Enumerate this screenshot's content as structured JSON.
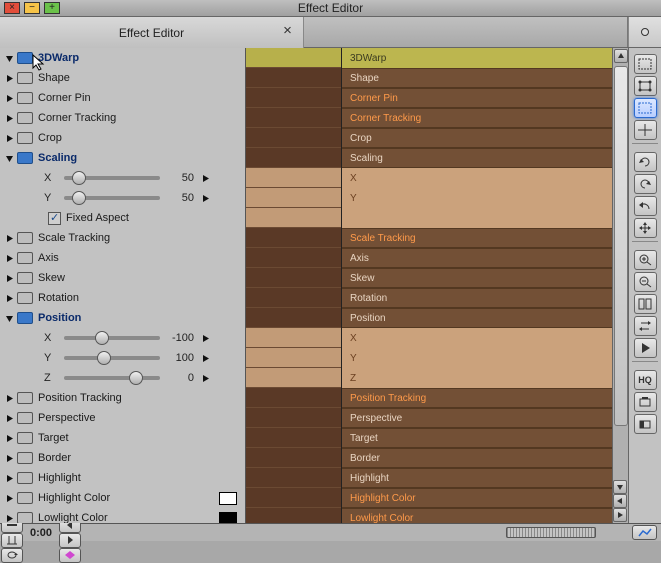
{
  "window": {
    "title": "Effect Editor",
    "tab_title": "Effect Editor"
  },
  "params": [
    {
      "key": "3dwarp",
      "label": "3DWarp",
      "kind": "head",
      "blue": true,
      "expanded": "down",
      "track": "3DWarp",
      "tstyle": "t-sel",
      "mstyle": "mid-sel"
    },
    {
      "key": "shape",
      "label": "Shape",
      "kind": "group",
      "expanded": "right",
      "track": "Shape",
      "tstyle": "t-dark",
      "mstyle": "mid-dark"
    },
    {
      "key": "cornerpin",
      "label": "Corner Pin",
      "kind": "group",
      "expanded": "right",
      "track": "Corner Pin",
      "tstyle": "t-dark t-hilite",
      "mstyle": "mid-dark"
    },
    {
      "key": "cornertracking",
      "label": "Corner Tracking",
      "kind": "group",
      "expanded": "right",
      "track": "Corner Tracking",
      "tstyle": "t-dark t-hilite",
      "mstyle": "mid-dark"
    },
    {
      "key": "crop",
      "label": "Crop",
      "kind": "group",
      "expanded": "right",
      "track": "Crop",
      "tstyle": "t-dark",
      "mstyle": "mid-dark"
    },
    {
      "key": "scaling",
      "label": "Scaling",
      "kind": "group",
      "blue": true,
      "expanded": "down",
      "track": "Scaling",
      "tstyle": "t-dark",
      "mstyle": "mid-dark"
    },
    {
      "key": "scale_x",
      "label": "X",
      "kind": "slider",
      "value": 50,
      "pos": 0.16,
      "track": "X",
      "tstyle": "t-lt",
      "mstyle": "mid-light"
    },
    {
      "key": "scale_y",
      "label": "Y",
      "kind": "slider",
      "value": 50,
      "pos": 0.16,
      "track": "Y",
      "tstyle": "t-lt",
      "mstyle": "mid-light"
    },
    {
      "key": "fixed_aspect",
      "label": "Fixed Aspect",
      "kind": "check",
      "checked": true,
      "tstyle": "t-lt",
      "mstyle": "mid-light"
    },
    {
      "key": "scaletracking",
      "label": "Scale Tracking",
      "kind": "group",
      "expanded": "right",
      "track": "Scale Tracking",
      "tstyle": "t-dark t-hilite",
      "mstyle": "mid-dark"
    },
    {
      "key": "axis",
      "label": "Axis",
      "kind": "group",
      "expanded": "right",
      "track": "Axis",
      "tstyle": "t-dark",
      "mstyle": "mid-dark"
    },
    {
      "key": "skew",
      "label": "Skew",
      "kind": "group",
      "expanded": "right",
      "track": "Skew",
      "tstyle": "t-dark",
      "mstyle": "mid-dark"
    },
    {
      "key": "rotation",
      "label": "Rotation",
      "kind": "group",
      "expanded": "right",
      "track": "Rotation",
      "tstyle": "t-dark",
      "mstyle": "mid-dark"
    },
    {
      "key": "position",
      "label": "Position",
      "kind": "group",
      "blue": true,
      "expanded": "down",
      "track": "Position",
      "tstyle": "t-dark",
      "mstyle": "mid-dark"
    },
    {
      "key": "pos_x",
      "label": "X",
      "kind": "slider",
      "value": -100,
      "pos": 0.4,
      "track": "X",
      "tstyle": "t-lt",
      "mstyle": "mid-light"
    },
    {
      "key": "pos_y",
      "label": "Y",
      "kind": "slider",
      "value": 100,
      "pos": 0.42,
      "track": "Y",
      "tstyle": "t-lt",
      "mstyle": "mid-light"
    },
    {
      "key": "pos_z",
      "label": "Z",
      "kind": "slider",
      "value": 0,
      "pos": 0.75,
      "track": "Z",
      "tstyle": "t-lt",
      "mstyle": "mid-light"
    },
    {
      "key": "positiontracking",
      "label": "Position Tracking",
      "kind": "group",
      "expanded": "right",
      "track": "Position Tracking",
      "tstyle": "t-dark t-hilite",
      "mstyle": "mid-dark"
    },
    {
      "key": "perspective",
      "label": "Perspective",
      "kind": "group",
      "expanded": "right",
      "track": "Perspective",
      "tstyle": "t-dark",
      "mstyle": "mid-dark"
    },
    {
      "key": "target",
      "label": "Target",
      "kind": "group",
      "expanded": "right",
      "track": "Target",
      "tstyle": "t-dark",
      "mstyle": "mid-dark"
    },
    {
      "key": "border",
      "label": "Border",
      "kind": "group",
      "expanded": "right",
      "track": "Border",
      "tstyle": "t-dark",
      "mstyle": "mid-dark"
    },
    {
      "key": "highlight",
      "label": "Highlight",
      "kind": "group",
      "expanded": "right",
      "track": "Highlight",
      "tstyle": "t-dark",
      "mstyle": "mid-dark"
    },
    {
      "key": "highlightcolor",
      "label": "Highlight Color",
      "kind": "color",
      "color": "#ffffff",
      "expanded": "right",
      "track": "Highlight Color",
      "tstyle": "t-dark t-hilite",
      "mstyle": "mid-dark"
    },
    {
      "key": "lowlightcolor",
      "label": "Lowlight Color",
      "kind": "color",
      "color": "#000000",
      "expanded": "right",
      "track": "Lowlight Color",
      "tstyle": "t-dark t-hilite",
      "mstyle": "mid-dark"
    }
  ],
  "transport": {
    "timecode": "0:00"
  },
  "tools": [
    {
      "name": "bounds-icon"
    },
    {
      "name": "transform-icon"
    },
    {
      "name": "select-icon",
      "active": true
    },
    {
      "name": "crosshair-icon"
    },
    {
      "name": "rotate-cw-icon"
    },
    {
      "name": "rotate-ccw-icon"
    },
    {
      "name": "undo-icon"
    },
    {
      "name": "move-icon"
    },
    {
      "name": "zoom-in-icon"
    },
    {
      "name": "zoom-out-icon"
    },
    {
      "name": "split-icon"
    },
    {
      "name": "swap-icon"
    },
    {
      "name": "play-icon"
    },
    {
      "name": "hq-icon"
    },
    {
      "name": "render-icon"
    },
    {
      "name": "render-range-icon"
    }
  ],
  "bottom_buttons": [
    {
      "name": "place-icon"
    },
    {
      "name": "strip-icon"
    },
    {
      "name": "io-icon"
    },
    {
      "name": "loop-icon"
    }
  ],
  "bottom_nav": [
    {
      "name": "rewind-icon"
    },
    {
      "name": "prev-icon"
    },
    {
      "name": "next-icon"
    },
    {
      "name": "kf-icon"
    }
  ]
}
